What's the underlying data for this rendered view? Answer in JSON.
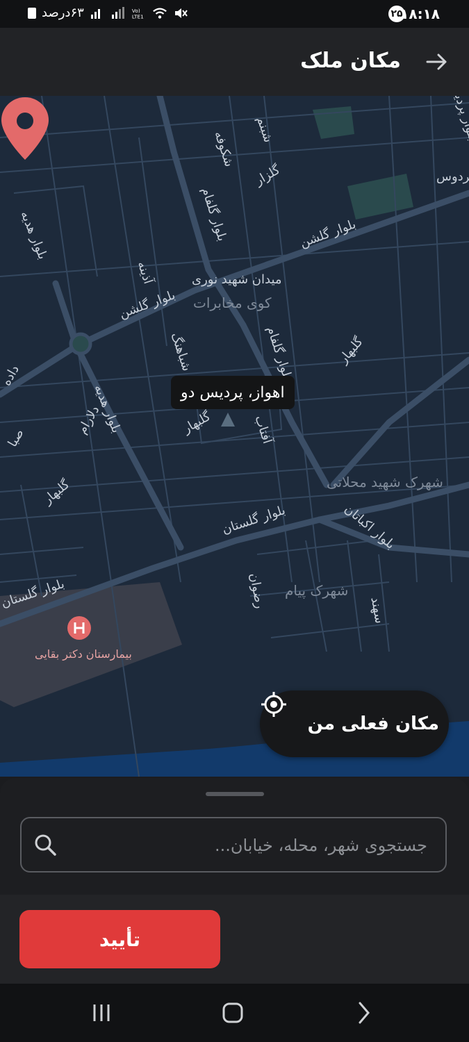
{
  "status_bar": {
    "time": "۱۸:۱۸",
    "notification_count": "۲۵",
    "battery_text": "۶۳درصد"
  },
  "header": {
    "title": "مکان ملک"
  },
  "map": {
    "tooltip": "اهواز، پردیس دو",
    "labels": {
      "bolvar_golshan_top": "بلوار گلشن",
      "bolvar_golshan_left": "بلوار گلشن",
      "bolvar_golfam_top": "بلوار گلفام",
      "bolvar_golfam_mid": "بلوار گلفام",
      "bolvar_hedieh_top": "بلوار هدیه",
      "bolvar_hedieh_mid": "بلوار هدیه",
      "bolvar_golestan_mid": "بلوار گلستان",
      "bolvar_golestan_left": "بلوار گلستان",
      "bolvar_akbatan": "بلوار اکباتان",
      "bolvar_top_right": "بلوار پردیس",
      "meydan": "میدان شهید نوری",
      "kooy": "کوی مخابرات",
      "shahrak_mahallati": "شهرک شهید محلاتی",
      "shahrak_payam": "شهرک پیام",
      "hospital": "بیمارستان دکتر بقایی",
      "shabnam": "شبنم",
      "shokoofeh": "شکوفه",
      "golzar": "گلزار",
      "ferdows": "فردوس",
      "azineh": "آذینه",
      "shabahang": "شباهنگ",
      "golbahar_1": "گلبهار",
      "golbahar_2": "گلبهار",
      "golbahar_3": "گلبهار",
      "aftab": "آفتاب",
      "dalaram": "دلارام",
      "dadeh": "داده",
      "saba": "صبا",
      "rezvan": "رضوان",
      "sahand": "سهند"
    },
    "current_location_label": "مکان فعلی من"
  },
  "search": {
    "placeholder": "جستجوی شهر، محله، خیابان..."
  },
  "footer": {
    "confirm_label": "تأیید"
  },
  "colors": {
    "accent": "#e03a3a",
    "map_bg": "#1d2a3b",
    "road": "#3b4e66",
    "pin": "#e36a6a"
  }
}
